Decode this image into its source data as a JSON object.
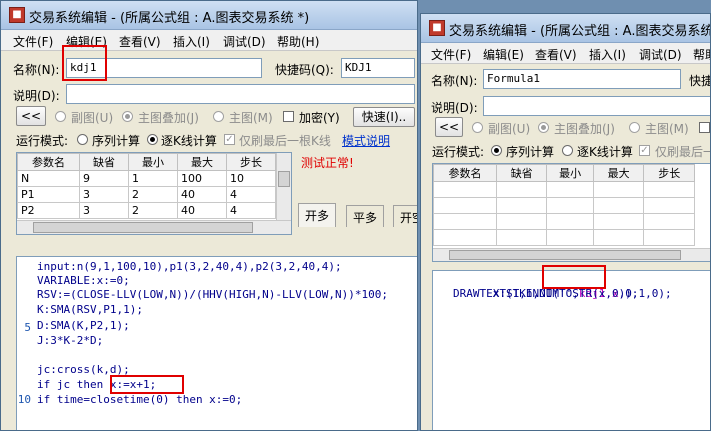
{
  "win1": {
    "title": "交易系统编辑 - (所属公式组 : A.图表交易系统 *)",
    "menu": [
      "文件(F)",
      "编辑(E)",
      "查看(V)",
      "插入(I)",
      "调试(D)",
      "帮助(H)"
    ],
    "name_label": "名称(N):",
    "name_value": "kdj1",
    "shortcut_label": "快捷码(Q):",
    "shortcut_value": "KDJ1",
    "desc_label": "说明(D):",
    "back_button": "<<",
    "radio_subchart": "副图(U)",
    "radio_mainoverlay": "主图叠加(J)",
    "radio_mainchart": "主图(M)",
    "encrypt_label": "加密(Y)",
    "quick_button": "快速(I)..",
    "runmode_label": "运行模式:",
    "mode_seq": "序列计算",
    "mode_bar": "逐K线计算",
    "only_last_label": "仅刷最后一根K线",
    "mode_help_link": "模式说明",
    "test_status": "测试正常!",
    "params_headers": [
      "参数名",
      "缺省",
      "最小",
      "最大",
      "步长"
    ],
    "params_rows": [
      [
        "N",
        "9",
        "1",
        "100",
        "10"
      ],
      [
        "P1",
        "3",
        "2",
        "40",
        "4"
      ],
      [
        "P2",
        "3",
        "2",
        "40",
        "4"
      ]
    ],
    "tabs": [
      "开多",
      "平多",
      "开空"
    ],
    "code_lines": [
      "input:n(9,1,100,10),p1(3,2,40,4),p2(3,2,40,4);",
      "VARIABLE:x:=0;",
      "RSV:=(CLOSE-LLV(LOW,N))/(HHV(HIGH,N)-LLV(LOW,N))*100;",
      "K:SMA(RSV,P1,1);",
      "D:SMA(K,P2,1);",
      "J:3*K-2*D;",
      "",
      "jc:cross(k,d);",
      "if jc then x:=x+1;",
      "if time=closetime(0) then x:=0;"
    ],
    "line_numbers": [
      "5",
      "10"
    ]
  },
  "win2": {
    "title": "交易系统编辑 - (所属公式组 : A.图表交易系统)",
    "menu": [
      "文件(F)",
      "编辑(E)",
      "查看(V)",
      "插入(I)",
      "调试(D)",
      "帮助"
    ],
    "name_label": "名称(N):",
    "name_value": "Formula1",
    "shortcut_label": "快捷",
    "desc_label": "说明(D):",
    "back_button": "<<",
    "radio_subchart": "副图(U)",
    "radio_mainoverlay": "主图叠加(J)",
    "radio_mainchart": "主图(M)",
    "runmode_label": "运行模式:",
    "mode_seq": "序列计算",
    "mode_bar": "逐K线计算",
    "only_last_label": "仅刷最后一",
    "params_headers": [
      "参数名",
      "缺省",
      "最小",
      "最大",
      "步长"
    ],
    "code_line1_prefix": "x:STKINDI('',",
    "code_line1_highlight": "kdj1.x",
    "code_line1_suffix": ",0,1,0);",
    "code_line2": "DRAWTEXT(1,h,NUMTOSTR(x,0));"
  },
  "colors": {
    "highlight_red": "#e00000",
    "code_blue": "#00008b",
    "link_blue": "#0033cc",
    "kdj_magenta": "#c000c0"
  }
}
